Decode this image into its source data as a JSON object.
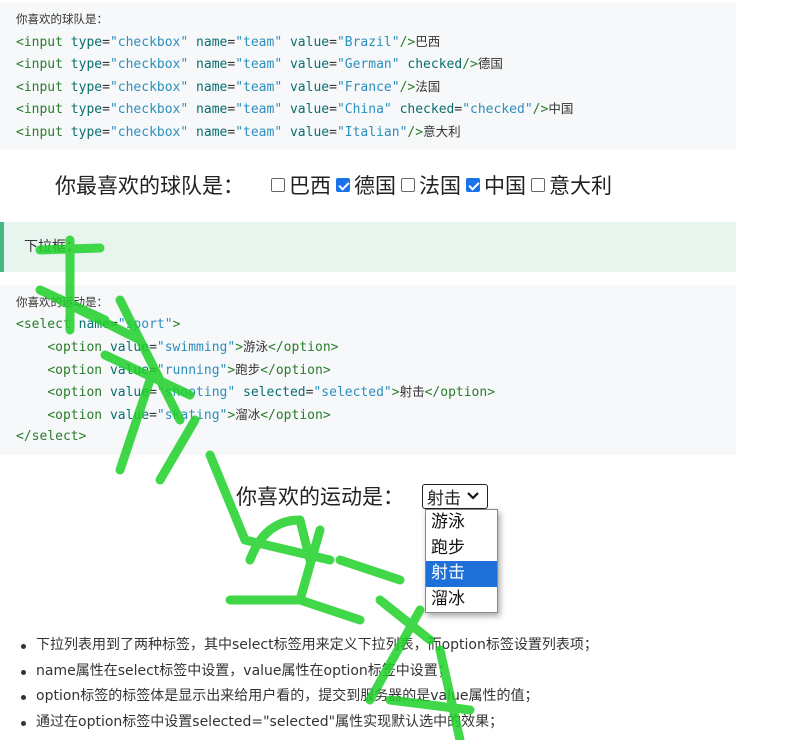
{
  "code_block_1": {
    "lines": [
      "你喜欢的球队是：",
      "<input type=\"checkbox\" name=\"team\" value=\"Brazil\"/>巴西",
      "<input type=\"checkbox\" name=\"team\" value=\"German\" checked/>德国",
      "<input type=\"checkbox\" name=\"team\" value=\"France\"/>法国",
      "<input type=\"checkbox\" name=\"team\" value=\"China\" checked=\"checked\"/>中国",
      "<input type=\"checkbox\" name=\"team\" value=\"Italian\"/>意大利"
    ]
  },
  "checkbox_demo": {
    "question": "你最喜欢的球队是：",
    "options": [
      {
        "label": "巴西",
        "checked": false
      },
      {
        "label": "德国",
        "checked": true
      },
      {
        "label": "法国",
        "checked": false
      },
      {
        "label": "中国",
        "checked": true
      },
      {
        "label": "意大利",
        "checked": false
      }
    ]
  },
  "tip": {
    "text": "下拉框："
  },
  "code_block_2": {
    "lines": [
      "你喜欢的运动是：",
      "<select name=\"sport\">",
      "    <option value=\"swimming\">游泳</option>",
      "    <option value=\"running\">跑步</option>",
      "    <option value=\"shooting\" selected=\"selected\">射击</option>",
      "    <option value=\"skating\">溜冰</option>",
      "</select>"
    ]
  },
  "select_demo": {
    "question": "你喜欢的运动是：",
    "selected": "射击",
    "options": [
      "游泳",
      "跑步",
      "射击",
      "溜冰"
    ],
    "highlighted": "射击",
    "icons": {
      "dropdown": "chevron-down-icon"
    }
  },
  "notes": [
    "下拉列表用到了两种标签，其中select标签用来定义下拉列表，而option标签设置列表项；",
    "name属性在select标签中设置，value属性在option标签中设置；",
    "option标签的标签体是显示出来给用户看的，提交到服务器的是value属性的值；",
    "通过在option标签中设置selected=\"selected\"属性实现默认选中的效果；"
  ],
  "colors": {
    "accent": "#42b983",
    "highlight": "#1e70d8",
    "checkbox": "#1a73e8",
    "watermark": "#1fd12a"
  }
}
